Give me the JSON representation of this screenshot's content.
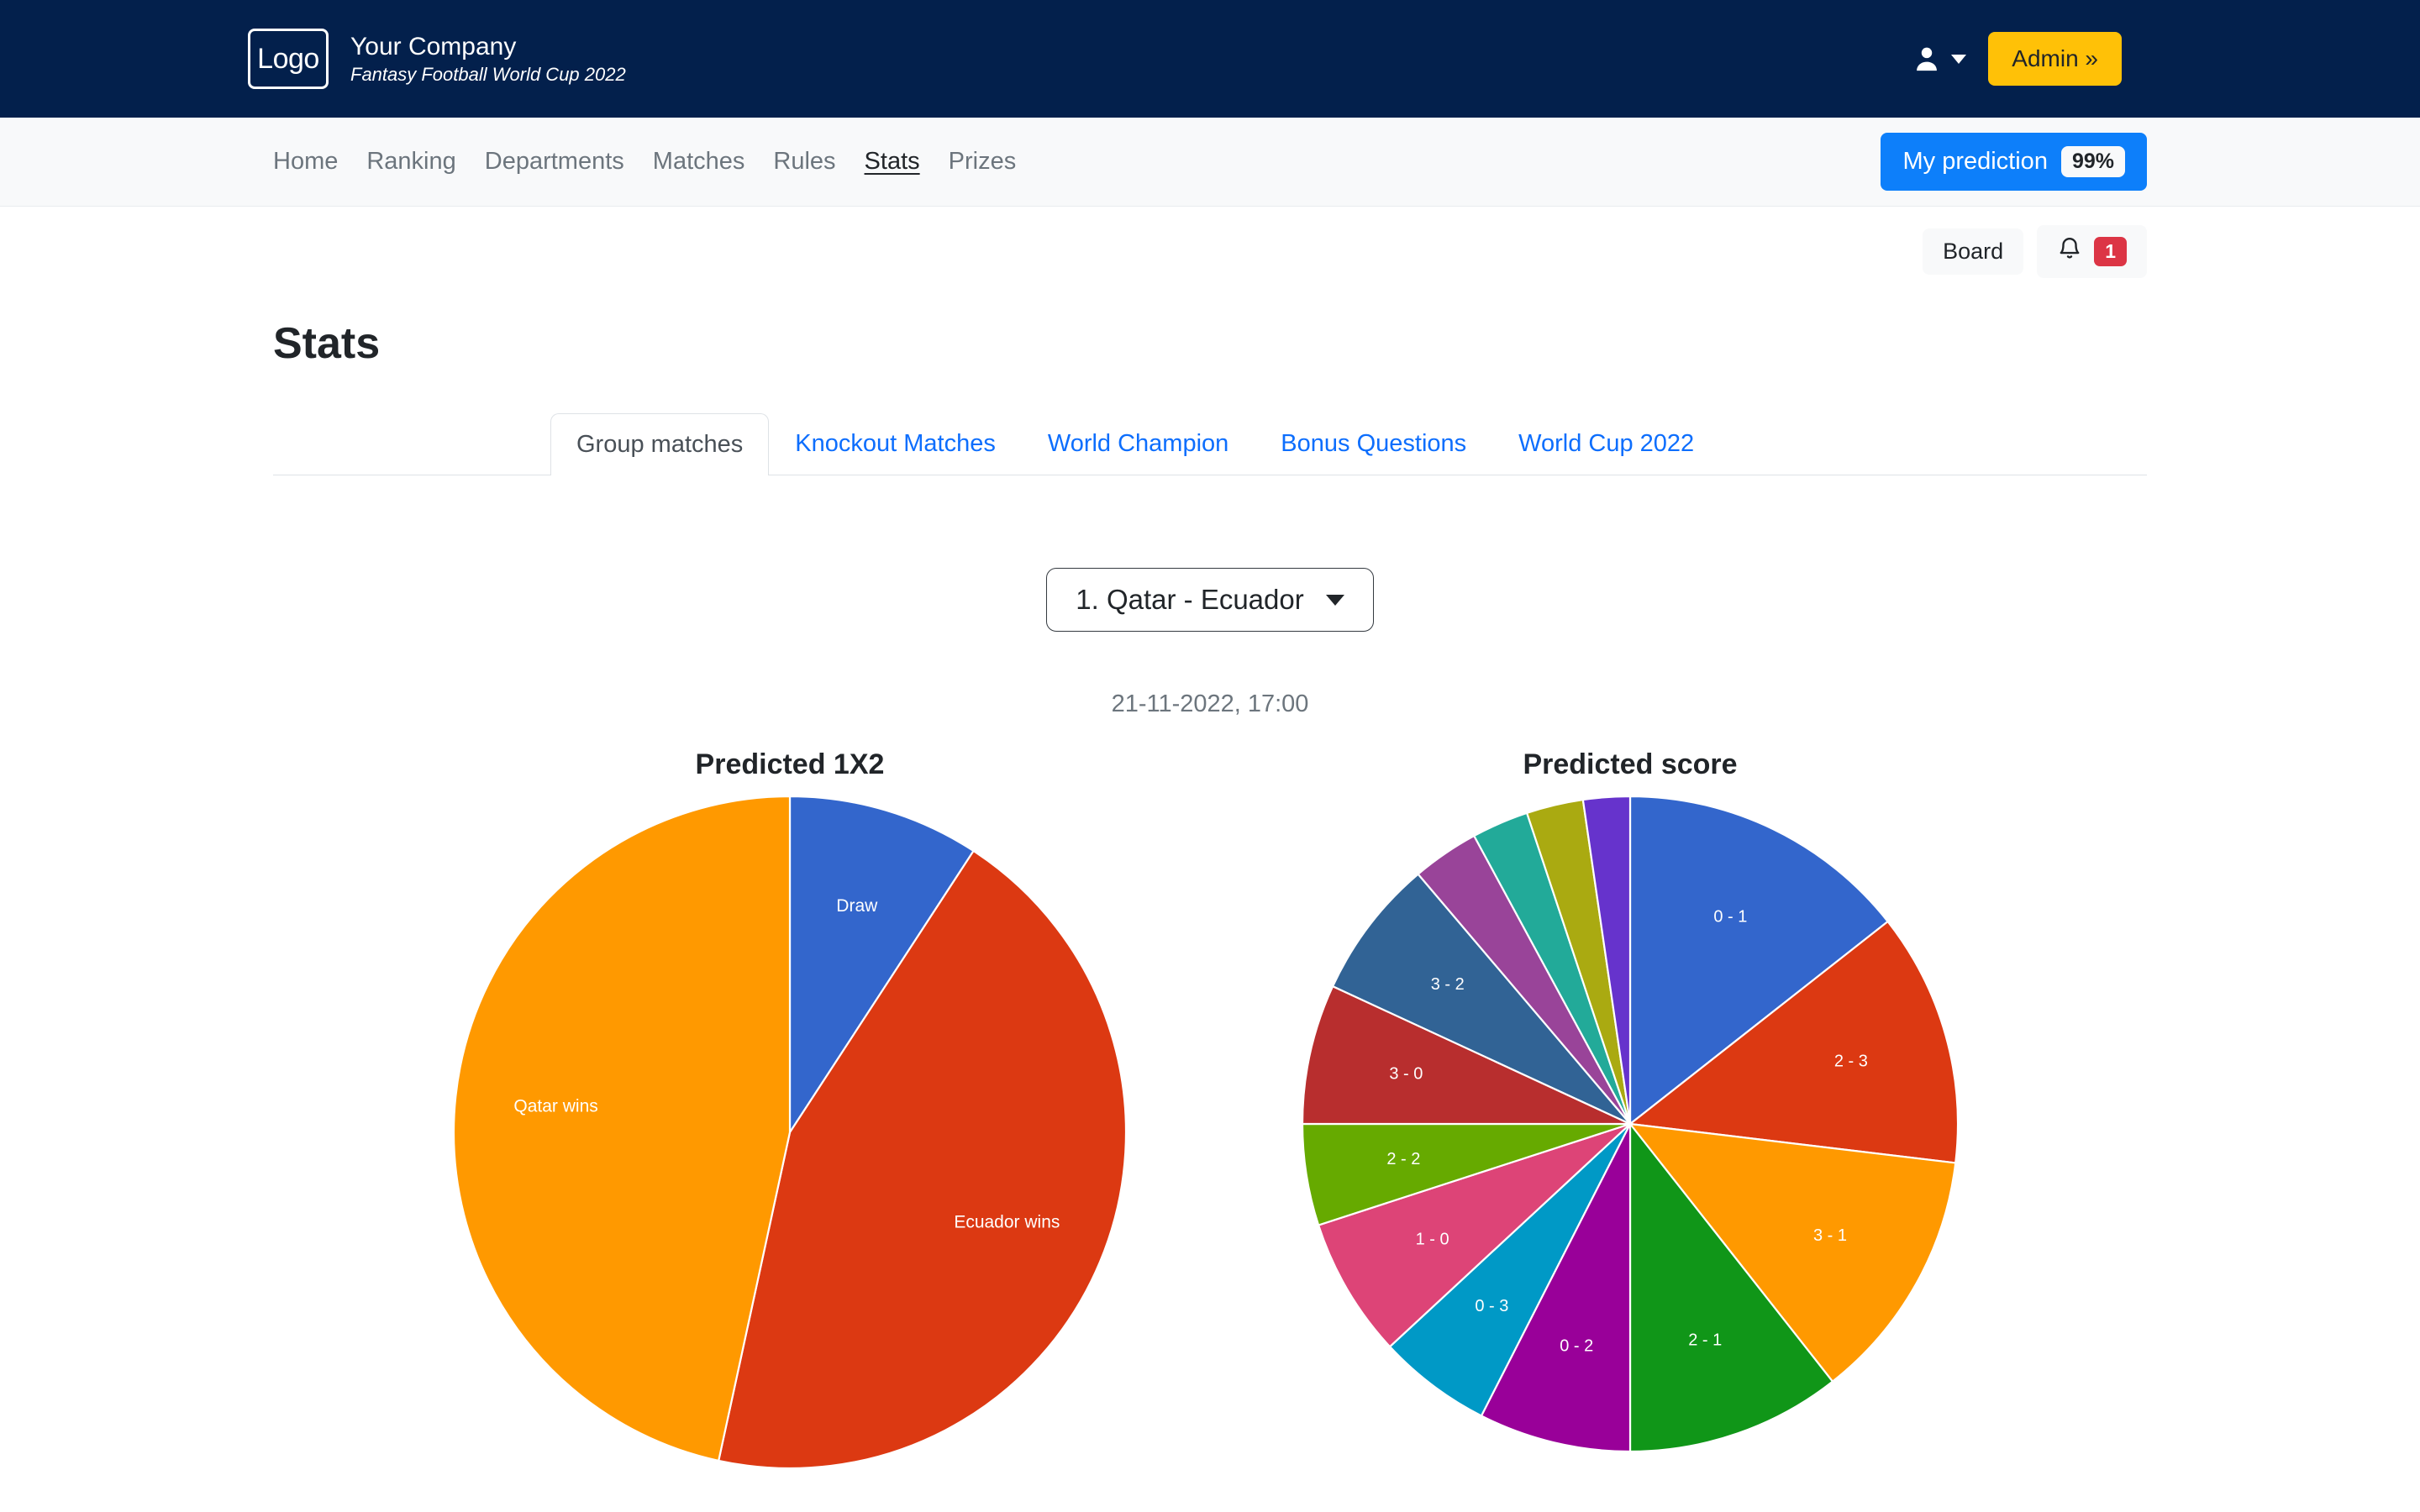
{
  "brand": {
    "logo_text": "Logo",
    "company": "Your Company",
    "tagline": "Fantasy Football World Cup 2022",
    "user_icon": "user-icon",
    "admin_label": "Admin »"
  },
  "nav": {
    "items": [
      {
        "label": "Home",
        "active": false
      },
      {
        "label": "Ranking",
        "active": false
      },
      {
        "label": "Departments",
        "active": false
      },
      {
        "label": "Matches",
        "active": false
      },
      {
        "label": "Rules",
        "active": false
      },
      {
        "label": "Stats",
        "active": true
      },
      {
        "label": "Prizes",
        "active": false
      }
    ],
    "prediction_label": "My prediction",
    "prediction_value": "99%"
  },
  "util": {
    "board_label": "Board",
    "bell_icon": "bell-icon",
    "notification_count": "1"
  },
  "page": {
    "title": "Stats"
  },
  "tabs": [
    {
      "label": "Group matches",
      "active": true
    },
    {
      "label": "Knockout Matches",
      "active": false
    },
    {
      "label": "World Champion",
      "active": false
    },
    {
      "label": "Bonus Questions",
      "active": false
    },
    {
      "label": "World Cup 2022",
      "active": false
    }
  ],
  "selector": {
    "selected": "1. Qatar - Ecuador",
    "caret_icon": "chevron-down-icon"
  },
  "match": {
    "datetime": "21-11-2022, 17:00"
  },
  "colors": {
    "brand_bar": "#03204c",
    "accent_yellow": "#ffc107",
    "accent_blue": "#0d7ffa",
    "danger_red": "#dc3545",
    "link_blue": "#0d6efd"
  },
  "chart_data": [
    {
      "type": "pie",
      "title": "Predicted 1X2",
      "labels": [
        "Draw",
        "Ecuador wins",
        "Qatar wins"
      ],
      "values": [
        9.2,
        44.2,
        46.6
      ],
      "colors": [
        "#3366cc",
        "#dc3912",
        "#ff9900"
      ],
      "legend": "none",
      "label_position": "inside",
      "start_angle": 0
    },
    {
      "type": "pie",
      "title": "Predicted score",
      "labels": [
        "0 - 1",
        "2 - 3",
        "3 - 1",
        "2 - 1",
        "0 - 2",
        "0 - 3",
        "1 - 0",
        "2 - 2",
        "3 - 0",
        "3 - 2",
        "",
        "",
        "",
        ""
      ],
      "values": [
        14.4,
        12.5,
        12.5,
        10.6,
        7.5,
        5.6,
        6.9,
        5.0,
        6.9,
        6.9,
        3.3,
        2.8,
        2.8,
        2.3
      ],
      "colors": [
        "#3366cc",
        "#dc3912",
        "#ff9900",
        "#109618",
        "#990099",
        "#0099c6",
        "#dd4477",
        "#66aa00",
        "#b82e2e",
        "#316395",
        "#994499",
        "#22aa99",
        "#aaaa11",
        "#6633cc"
      ],
      "legend": "none",
      "label_position": "inside",
      "start_angle": 0
    }
  ]
}
